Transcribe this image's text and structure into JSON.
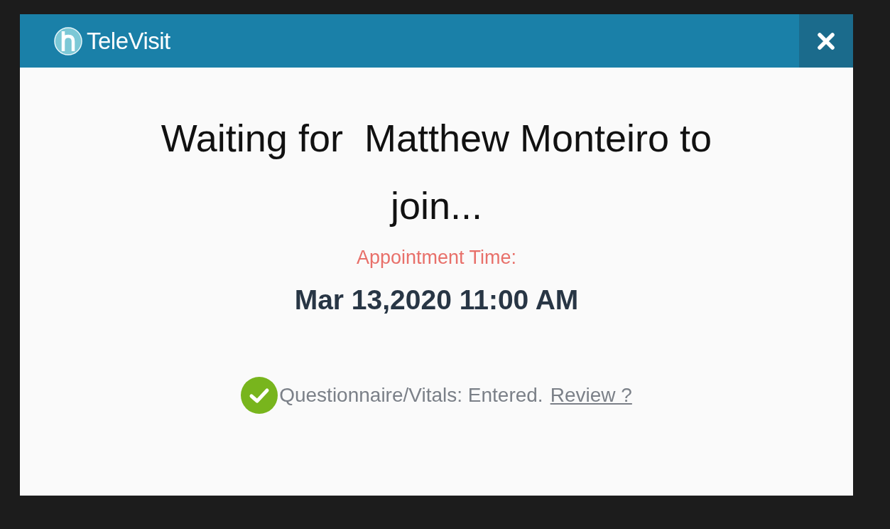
{
  "dialog": {
    "app_name": "TeleVisit",
    "heading": "Waiting for  Matthew Monteiro to join...",
    "appointment_label": "Appointment Time:",
    "appointment_time": "Mar 13,2020 11:00 AM",
    "questionnaire": {
      "checked": true,
      "text": "Questionnaire/Vitals: Entered.",
      "link": "Review ?"
    }
  }
}
